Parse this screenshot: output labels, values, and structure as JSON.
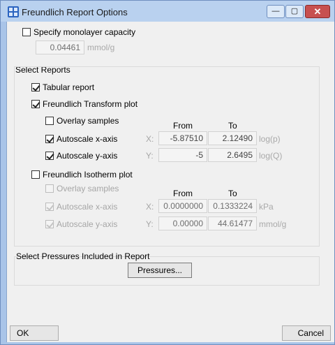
{
  "window": {
    "title": "Freundlich Report Options",
    "minimize_glyph": "—",
    "maximize_glyph": "▢",
    "close_glyph": "✕"
  },
  "monolayer": {
    "label": "Specify monolayer capacity",
    "checked": false,
    "value": "0.04461",
    "unit": "mmol/g"
  },
  "reports": {
    "group_label": "Select Reports",
    "tabular": {
      "label": "Tabular report",
      "checked": true
    },
    "transform": {
      "label": "Freundlich Transform plot",
      "checked": true,
      "overlay_label": "Overlay samples",
      "from_header": "From",
      "to_header": "To",
      "x": {
        "label": "Autoscale x-axis",
        "axis": "X:",
        "from": "-5.87510",
        "to": "2.12490",
        "unit": "log(p)"
      },
      "y": {
        "label": "Autoscale y-axis",
        "axis": "Y:",
        "from": "-5",
        "to": "2.6495",
        "unit": "log(Q)"
      }
    },
    "isotherm": {
      "label": "Freundlich Isotherm plot",
      "checked": false,
      "overlay_label": "Overlay samples",
      "from_header": "From",
      "to_header": "To",
      "x": {
        "label": "Autoscale x-axis",
        "axis": "X:",
        "from": "0.0000000",
        "to": "0.1333224",
        "unit": "kPa"
      },
      "y": {
        "label": "Autoscale y-axis",
        "axis": "Y:",
        "from": "0.00000",
        "to": "44.61477",
        "unit": "mmol/g"
      }
    }
  },
  "pressures": {
    "group_label": "Select Pressures Included in Report",
    "button_label": "Pressures..."
  },
  "footer": {
    "ok_label": "OK",
    "cancel_label": "Cancel"
  }
}
